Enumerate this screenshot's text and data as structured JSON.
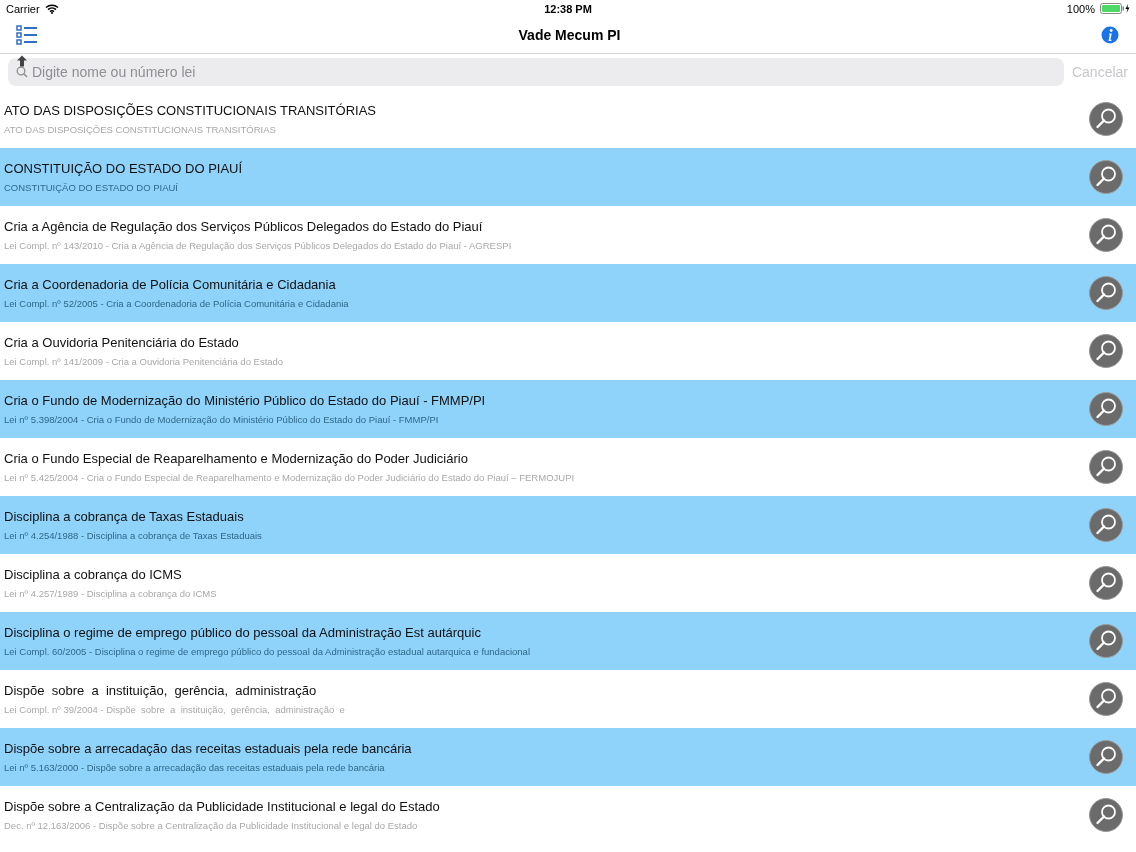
{
  "status_bar": {
    "carrier": "Carrier",
    "time": "12:38 PM",
    "battery": "100%"
  },
  "nav": {
    "title": "Vade Mecum PI"
  },
  "search": {
    "placeholder": "Digite nome ou número lei",
    "cancel": "Cancelar"
  },
  "rows": [
    {
      "title": "ATO DAS DISPOSIÇÕES CONSTITUCIONAIS TRANSITÓRIAS",
      "subtitle": "ATO DAS DISPOSIÇÕES CONSTITUCIONAIS TRANSITÓRIAS",
      "highlighted": false
    },
    {
      "title": "CONSTITUIÇÃO DO ESTADO DO PIAUÍ",
      "subtitle": "CONSTITUIÇÃO DO ESTADO DO PIAUÍ",
      "highlighted": true
    },
    {
      "title": "Cria a Agência de Regulação dos Serviços Públicos Delegados do Estado do Piauí",
      "subtitle": "Lei Compl. nº 143/2010 - Cria a Agência de Regulação dos Serviços Públicos Delegados do Estado do Piauí - AGRESPI",
      "highlighted": false
    },
    {
      "title": "Cria a Coordenadoria de Polícia Comunitária e Cidadania",
      "subtitle": "Lei Compl. nº 52/2005 - Cria a Coordenadoria de Polícia Comunitária e Cidadania",
      "highlighted": true
    },
    {
      "title": "Cria a Ouvidoria Penitenciária do Estado",
      "subtitle": "Lei Compl. nº 141/2009 - Cria a Ouvidoria Penitenciária do Estado",
      "highlighted": false
    },
    {
      "title": "Cria o Fundo de Modernização do Ministério Público do Estado do Piauí - FMMP/PI",
      "subtitle": "Lei nº 5.398/2004 - Cria o Fundo de Modernização do Ministério Público do Estado do Piauí - FMMP/PI",
      "highlighted": true
    },
    {
      "title": "Cria o Fundo Especial de Reaparelhamento e Modernização do Poder Judiciário",
      "subtitle": "Lei nº 5.425/2004 - Cria o Fundo Especial de Reaparelhamento e Modernização do Poder Judiciário do Estado do Piauí – FERMOJUPI",
      "highlighted": false
    },
    {
      "title": "Disciplina a cobrança de Taxas Estaduais",
      "subtitle": "Lei nº 4.254/1988 - Disciplina a cobrança de Taxas Estaduais",
      "highlighted": true
    },
    {
      "title": "Disciplina a cobrança do ICMS",
      "subtitle": "Lei nº 4.257/1989 - Disciplina a cobrança do ICMS",
      "highlighted": false
    },
    {
      "title": "Disciplina o regime de emprego público do pessoal da Administração Est autárquic",
      "subtitle": "Lei Compl. 60/2005 - Disciplina o regime de emprego público do pessoal da Administração estadual autarquica e fundacional",
      "highlighted": true
    },
    {
      "title": "Dispõe  sobre  a  instituição,  gerência,  administração",
      "subtitle": "Lei Compl. nº 39/2004 - Dispõe  sobre  a  instituição,  gerência,  administração  e",
      "highlighted": false
    },
    {
      "title": "Dispõe sobre a arrecadação das receitas estaduais pela rede bancária",
      "subtitle": "Lei nº 5.163/2000 - Dispõe sobre a arrecadação das receitas estaduais pela rede bancária",
      "highlighted": true
    },
    {
      "title": "Dispõe sobre a Centralização da Publicidade Institucional e legal do Estado",
      "subtitle": "Dec. nº 12.163/2006 - Dispõe sobre a Centralização da Publicidade Institucional e legal do Estado",
      "highlighted": false
    }
  ]
}
